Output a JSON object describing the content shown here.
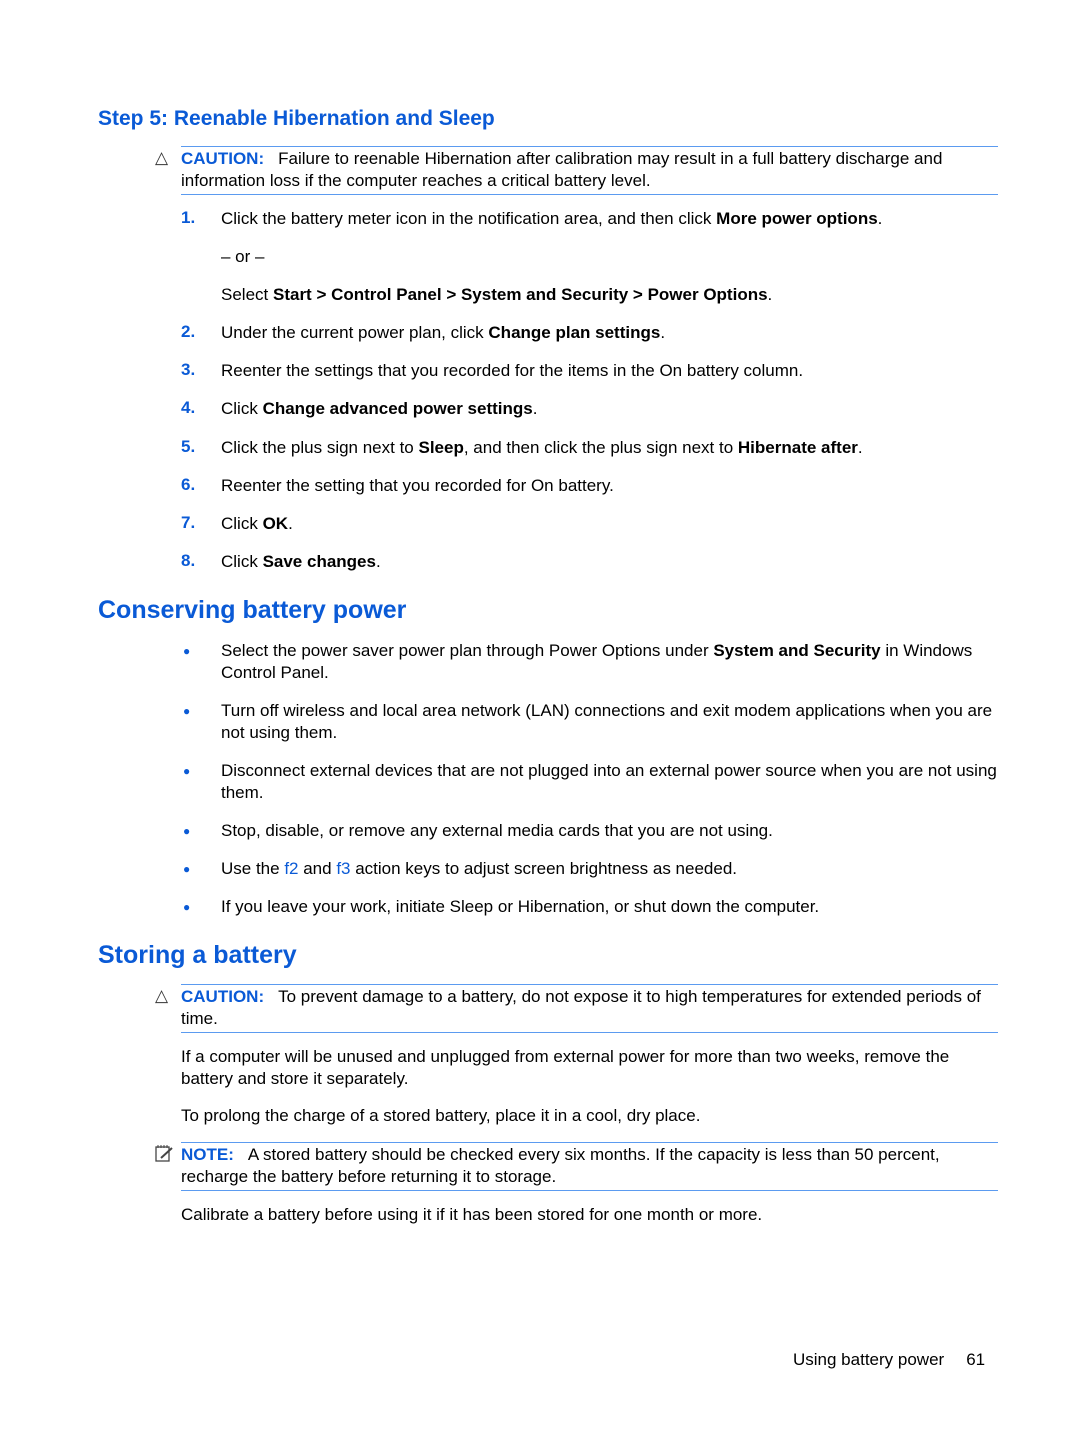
{
  "step5": {
    "heading": "Step 5: Reenable Hibernation and Sleep",
    "caution": {
      "icon": "warning-triangle-icon",
      "label": "CAUTION:",
      "text": "Failure to reenable Hibernation after calibration may result in a full battery discharge and information loss if the computer reaches a critical battery level."
    },
    "steps": [
      {
        "num": "1.",
        "pre": "Click the battery meter icon in the notification area, and then click ",
        "bold": "More power options",
        "post": "."
      },
      {
        "or": "– or –"
      },
      {
        "pre": "Select ",
        "bold": "Start > Control Panel > System and Security > Power Options",
        "post": "."
      },
      {
        "num": "2.",
        "pre": "Under the current power plan, click ",
        "bold": "Change plan settings",
        "post": "."
      },
      {
        "num": "3.",
        "pre": "Reenter the settings that you recorded for the items in the On battery column.",
        "bold": "",
        "post": ""
      },
      {
        "num": "4.",
        "pre": "Click ",
        "bold": "Change advanced power settings",
        "post": "."
      },
      {
        "num": "5.",
        "pre": "Click the plus sign next to ",
        "bold": "Sleep",
        "mid": ", and then click the plus sign next to ",
        "bold2": "Hibernate after",
        "post": "."
      },
      {
        "num": "6.",
        "pre": "Reenter the setting that you recorded for On battery.",
        "bold": "",
        "post": ""
      },
      {
        "num": "7.",
        "pre": "Click ",
        "bold": "OK",
        "post": "."
      },
      {
        "num": "8.",
        "pre": "Click ",
        "bold": "Save changes",
        "post": "."
      }
    ]
  },
  "conserving": {
    "heading": "Conserving battery power",
    "bullets": [
      {
        "pre": "Select the power saver power plan through Power Options under ",
        "bold": "System and Security",
        "post": " in Windows Control Panel."
      },
      {
        "pre": "Turn off wireless and local area network (LAN) connections and exit modem applications when you are not using them."
      },
      {
        "pre": "Disconnect external devices that are not plugged into an external power source when you are not using them."
      },
      {
        "pre": "Stop, disable, or remove any external media cards that you are not using."
      },
      {
        "pre": "Use the ",
        "key1": "f2",
        "mid": " and ",
        "key2": "f3",
        "post": " action keys to adjust screen brightness as needed."
      },
      {
        "pre": "If you leave your work, initiate Sleep or Hibernation, or shut down the computer."
      }
    ]
  },
  "storing": {
    "heading": "Storing a battery",
    "caution": {
      "icon": "warning-triangle-icon",
      "label": "CAUTION:",
      "text": "To prevent damage to a battery, do not expose it to high temperatures for extended periods of time."
    },
    "para1": "If a computer will be unused and unplugged from external power for more than two weeks, remove the battery and store it separately.",
    "para2": "To prolong the charge of a stored battery, place it in a cool, dry place.",
    "note": {
      "icon": "note-pencil-icon",
      "label": "NOTE:",
      "text": "A stored battery should be checked every six months. If the capacity is less than 50 percent, recharge the battery before returning it to storage."
    },
    "para3": "Calibrate a battery before using it if it has been stored for one month or more."
  },
  "footer": {
    "section": "Using battery power",
    "page": "61"
  }
}
